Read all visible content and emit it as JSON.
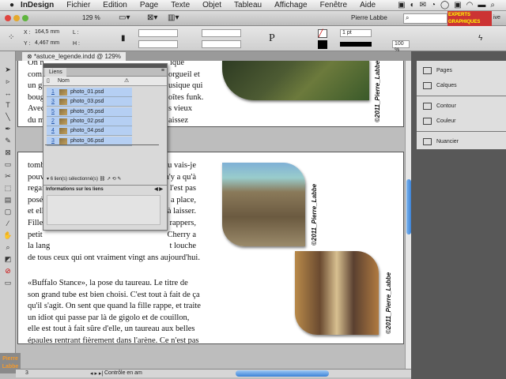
{
  "menubar": {
    "apple": "",
    "items": [
      "InDesign",
      "Fichier",
      "Edition",
      "Page",
      "Texte",
      "Objet",
      "Tableau",
      "Affichage",
      "Fenêtre",
      "Aide"
    ]
  },
  "appbar": {
    "zoom": "129 %",
    "user": "Pierre Labbe",
    "logo": "EXPERTS GRAPHIQUES",
    "workspace": "ive"
  },
  "control": {
    "x_label": "X :",
    "x_value": "164,5 mm",
    "y_label": "Y :",
    "y_value": "4,467 mm",
    "w_label": "L :",
    "h_label": "H :",
    "stroke_weight": "1 pt",
    "scale": "100 %"
  },
  "document": {
    "tab": "*astuce_legende.indd @ 129%"
  },
  "page1": {
    "lines": [
      [
        "On n",
        "ique"
      ],
      [
        "comi",
        "orgueil et"
      ],
      [
        "un gl",
        "usique qui"
      ],
      [
        "boug",
        "oîtes funk."
      ],
      [
        "Avec",
        "s vieux"
      ],
      [
        "du m",
        "aissez"
      ]
    ]
  },
  "page2": {
    "partial": [
      [
        "tomb",
        "eau vais-je"
      ],
      [
        "pouv",
        "Il n'y a qu'à"
      ],
      [
        "regar",
        "se l'est pas"
      ],
      [
        "posé",
        "a place,"
      ],
      [
        "et ell",
        "à laisser."
      ],
      [
        "Fille",
        "rappers,"
      ],
      [
        "petit",
        "Cherry a"
      ],
      [
        "la lang",
        "t louche"
      ]
    ],
    "full": [
      "de tous ceux qui ont vraiment vingt ans aujourd'hui.",
      "",
      "«Buffalo Stance», la pose du taureau. Le titre de",
      "son grand tube est bien choisi. C'est tout à fait de ça",
      "qu'il s'agit. On sent que quand la fille rappe, et traite",
      "un idiot qui passe par là de gigolo et de couillon,",
      "elle est tout à fait sûre d'elle, un taureau aux belles",
      "épaules rentrant fièrement dans l'arène. Ce n'est pas",
      "pour rien que Neneh Cherry a appelé sa fille Tyson,",
      "un nom qu'elle pourrait revendiquer pour elle!"
    ]
  },
  "captions": [
    "©2011_Pierre_Labbe",
    "©2011_Pierre_Labbe",
    "©2011_Pierre_Labbe"
  ],
  "links_panel": {
    "title": "Liens",
    "col_name": "Nom",
    "rows": [
      {
        "page": "1",
        "name": "photo_01.psd"
      },
      {
        "page": "3",
        "name": "photo_03.psd"
      },
      {
        "page": "5",
        "name": "photo_05.psd"
      },
      {
        "page": "2",
        "name": "photo_02.psd"
      },
      {
        "page": "4",
        "name": "photo_04.psd"
      },
      {
        "page": "3",
        "name": "photo_06.psd"
      }
    ],
    "status": "6 lien(s) sélectionné(s)",
    "info_title": "Informations sur les liens"
  },
  "right_panel": {
    "items": [
      "Pages",
      "Calques",
      "Contour",
      "Couleur",
      "Nuancier"
    ]
  },
  "statusbar": {
    "page": "3",
    "preflight": "Contrôle en am"
  },
  "watermark": "Pierre Labbe",
  "colors": {
    "selection": "#b5cff3",
    "accent": "#4a90e2"
  }
}
